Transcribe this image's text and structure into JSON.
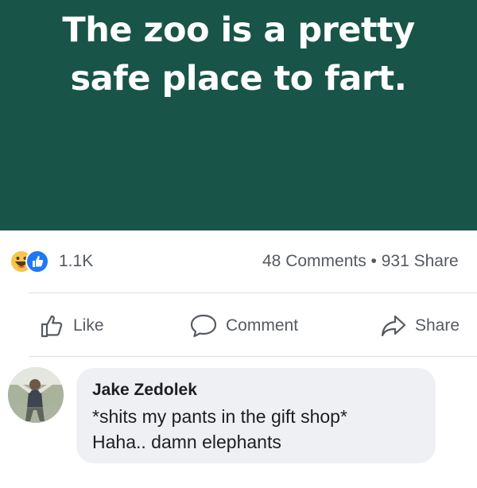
{
  "post": {
    "text_line1": "The zoo is a pretty",
    "text_line2": "safe place to fart.",
    "background_color": "#195448"
  },
  "stats": {
    "reaction_icons": [
      "haha-reaction",
      "like-reaction"
    ],
    "reaction_count": "1.1K",
    "comments_shares": "48 Comments • 931 Share"
  },
  "actions": {
    "like_label": "Like",
    "comment_label": "Comment",
    "share_label": "Share"
  },
  "comment": {
    "author": "Jake Zedolek",
    "line1": "*shits my pants in the gift shop*",
    "line2": "Haha.. damn elephants"
  }
}
